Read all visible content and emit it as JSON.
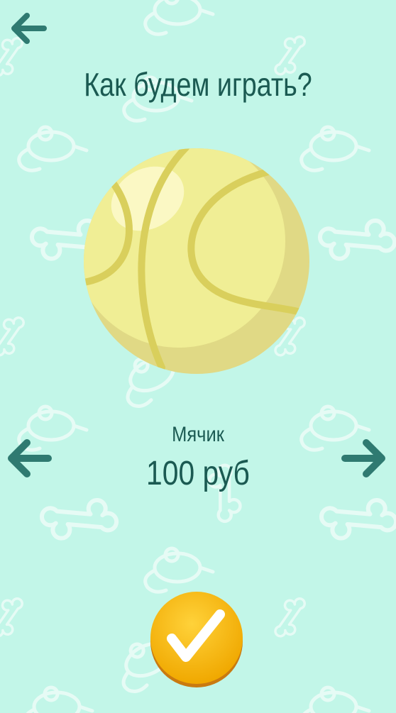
{
  "header": {
    "title": "Как будем играть?"
  },
  "item": {
    "name": "Мячик",
    "price": "100 руб"
  },
  "icons": {
    "back": "arrow-left-icon",
    "prev": "arrow-left-icon",
    "next": "arrow-right-icon",
    "confirm": "checkmark-icon",
    "item_image": "tennis-ball-icon"
  },
  "colors": {
    "background": "#c2f6e8",
    "pattern": "#e6fbf5",
    "text": "#1b5a52",
    "arrow": "#2f7a71",
    "ball": "#f0ee95",
    "ball_shade": "#e0d985",
    "ball_seam": "#d9cf5c",
    "button": "#f7b500"
  }
}
